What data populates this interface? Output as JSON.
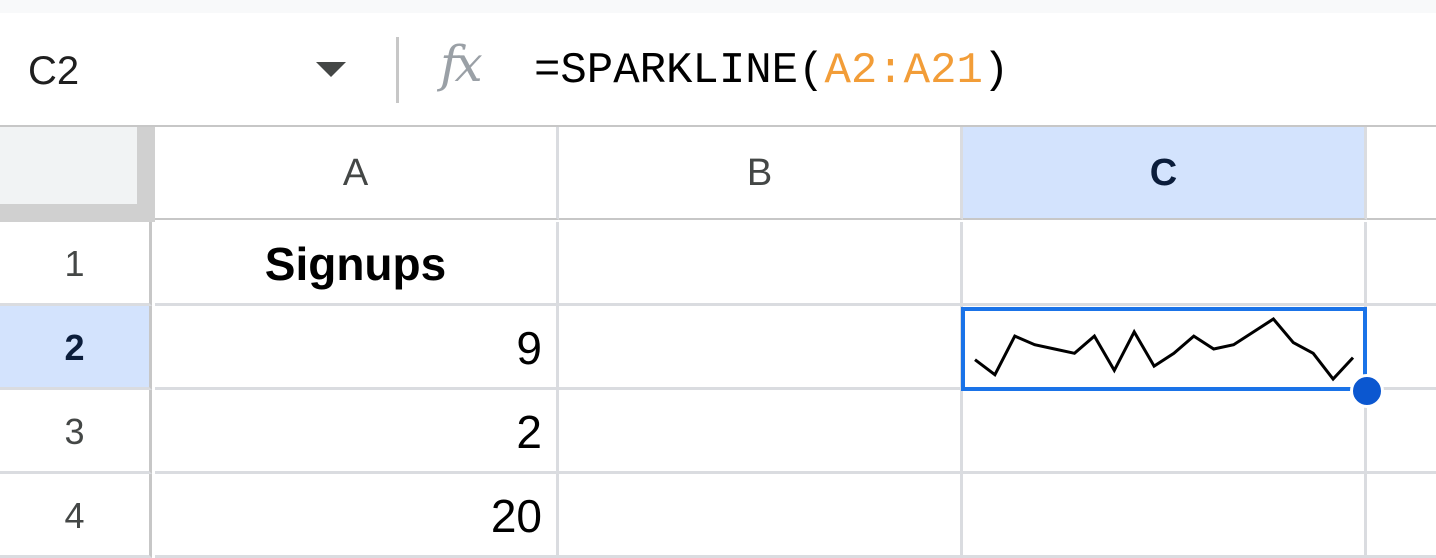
{
  "formula_bar": {
    "name_box": "C2",
    "fx_label": "fx",
    "formula_prefix": "=SPARKLINE(",
    "formula_ref": "A2:A21",
    "formula_suffix": ")"
  },
  "columns": [
    "A",
    "B",
    "C"
  ],
  "rows": [
    "1",
    "2",
    "3",
    "4"
  ],
  "cells": {
    "A1": "Signups",
    "A2": "9",
    "A3": "2",
    "A4": "20"
  },
  "selection": {
    "active_cell": "C2",
    "active_column": "C",
    "active_row": "2"
  },
  "sparkline": {
    "source_range": "A2:A21",
    "values": [
      9,
      2,
      20,
      16,
      14,
      12,
      20,
      4,
      22,
      6,
      12,
      20,
      14,
      16,
      22,
      28,
      17,
      12,
      0,
      10
    ],
    "color": "#000000"
  },
  "colors": {
    "selection": "#1a73e8",
    "header_highlight": "#d3e3fd",
    "reference": "#f29d38"
  }
}
